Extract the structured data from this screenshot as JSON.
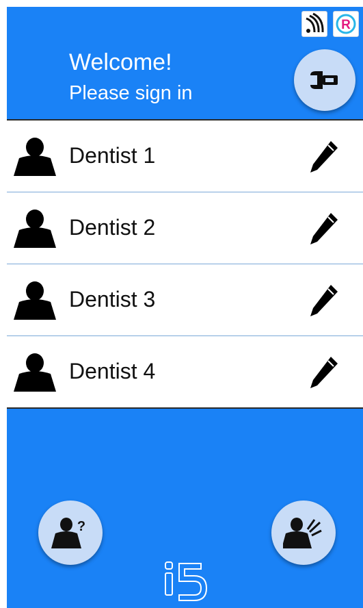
{
  "header": {
    "welcome": "Welcome!",
    "subtitle": "Please sign in",
    "accent": "#1a82f6"
  },
  "icons": {
    "nfc": "nfc-icon",
    "r_badge": "r-badge-icon",
    "settings": "wrench-icon",
    "help": "user-question-icon",
    "call": "user-signal-icon",
    "logo": "i5-logo"
  },
  "users": [
    {
      "name": "Dentist 1"
    },
    {
      "name": "Dentist 2"
    },
    {
      "name": "Dentist 3"
    },
    {
      "name": "Dentist 4"
    }
  ]
}
